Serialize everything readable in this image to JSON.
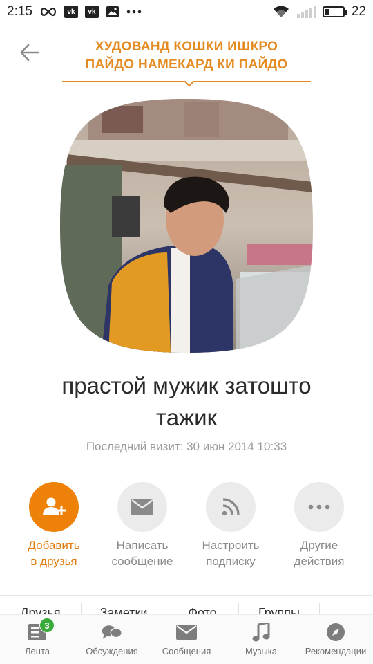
{
  "status_bar": {
    "time": "2:15",
    "battery": "22",
    "icons": [
      "infinity-icon",
      "vk-icon",
      "vk-icon",
      "image-icon",
      "more-dots-icon",
      "wifi-icon",
      "signal-icon",
      "battery-icon"
    ]
  },
  "header": {
    "status_line1": "ХУДОВАНД КОШКИ ИШКРО",
    "status_line2": "ПАЙДО НАМЕКАРД КИ ПАЙДО"
  },
  "profile": {
    "name_line1": "прастой мужик затошто",
    "name_line2": "тажик",
    "last_visit": "Последний визит: 30 июн 2014 10:33"
  },
  "actions": [
    {
      "line1": "Добавить",
      "line2": "в друзья",
      "icon": "add-friend-icon"
    },
    {
      "line1": "Написать",
      "line2": "сообщение",
      "icon": "envelope-icon"
    },
    {
      "line1": "Настроить",
      "line2": "подписку",
      "icon": "rss-icon"
    },
    {
      "line1": "Другие",
      "line2": "действия",
      "icon": "more-dots-icon"
    }
  ],
  "tabs": [
    "Друзья",
    "Заметки",
    "Фото",
    "Группы"
  ],
  "bottom_nav": [
    {
      "label": "Лента",
      "badge": "3",
      "icon": "feed-icon"
    },
    {
      "label": "Обсуждения",
      "icon": "discussions-icon"
    },
    {
      "label": "Сообщения",
      "icon": "envelope-icon"
    },
    {
      "label": "Музыка",
      "icon": "music-icon"
    },
    {
      "label": "Рекомендации",
      "icon": "compass-icon"
    }
  ],
  "colors": {
    "accent": "#ee8208",
    "status_text": "#e38a21",
    "badge": "#3aab3a"
  }
}
